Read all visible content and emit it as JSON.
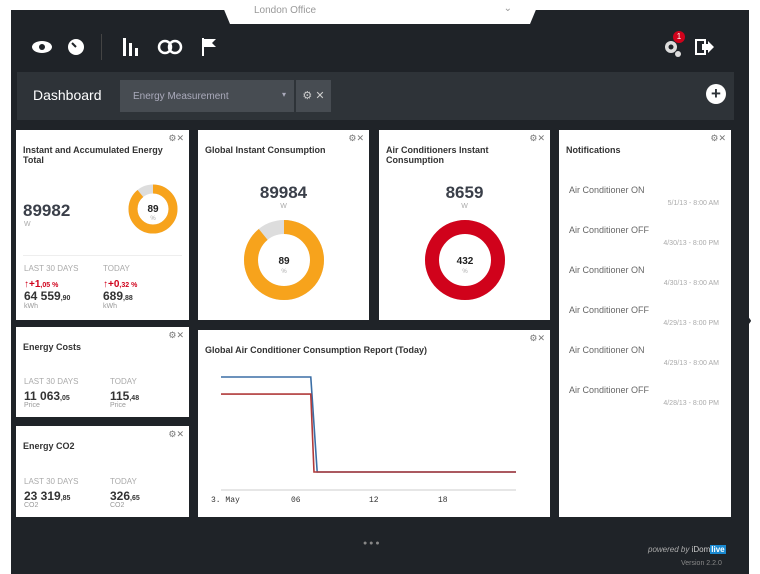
{
  "location": {
    "label": "London Office"
  },
  "nav": {
    "icons": [
      "eye-icon",
      "gauge-icon",
      "bar-chart-icon",
      "loop-icon",
      "flag-icon"
    ]
  },
  "header": {
    "notification_count": "1"
  },
  "toolbar": {
    "title": "Dashboard",
    "selector_value": "Energy Measurement",
    "controls": "⚙ ✕",
    "add": "+"
  },
  "widgets": {
    "instant_accumulated": {
      "title": "Instant and Accumulated Energy Total",
      "value": "89982",
      "unit": "W",
      "gauge": "89",
      "gauge_unit": "%",
      "gauge_fraction": 0.89,
      "last30_label": "LAST 30 DAYS",
      "last30_change": "+1",
      "last30_change_dec": ",05 %",
      "last30_value": "64 559",
      "last30_dec": ",90",
      "last30_unit": "kWh",
      "today_label": "TODAY",
      "today_change": "+0",
      "today_change_dec": ",32 %",
      "today_value": "689",
      "today_dec": ",88",
      "today_unit": "kWh"
    },
    "global_instant": {
      "title": "Global Instant Consumption",
      "value": "89984",
      "unit": "W",
      "gauge": "89",
      "gauge_unit": "%",
      "gauge_fraction": 0.89
    },
    "ac_instant": {
      "title": "Air Conditioners Instant Consumption",
      "value": "8659",
      "unit": "W",
      "gauge": "432",
      "gauge_unit": "%",
      "gauge_fraction": 1.0
    },
    "energy_costs": {
      "title": "Energy Costs",
      "last30_label": "LAST 30 DAYS",
      "last30_value": "11 063",
      "last30_dec": ",05",
      "last30_unit": "Price",
      "today_label": "TODAY",
      "today_value": "115",
      "today_dec": ",48",
      "today_unit": "Price"
    },
    "energy_co2": {
      "title": "Energy CO2",
      "last30_label": "LAST 30 DAYS",
      "last30_value": "23 319",
      "last30_dec": ",85",
      "last30_unit": "CO2",
      "today_label": "TODAY",
      "today_value": "326",
      "today_dec": ",65",
      "today_unit": "CO2"
    },
    "ac_report": {
      "title": "Global Air Conditioner Consumption Report (Today)"
    },
    "notifications": {
      "title": "Notifications",
      "items": [
        {
          "text": "Air Conditioner ON",
          "date": "5/1/13 - 8:00 AM"
        },
        {
          "text": "Air Conditioner OFF",
          "date": "4/30/13 - 8:00 PM"
        },
        {
          "text": "Air Conditioner ON",
          "date": "4/30/13 - 8:00 AM"
        },
        {
          "text": "Air Conditioner OFF",
          "date": "4/29/13 - 8:00 PM"
        },
        {
          "text": "Air Conditioner ON",
          "date": "4/29/13 - 8:00 AM"
        },
        {
          "text": "Air Conditioner OFF",
          "date": "4/28/13 - 8:00 PM"
        }
      ]
    }
  },
  "colors": {
    "orange": "#f7a31c",
    "red": "#d0021b",
    "blue": "#3b6ea5",
    "chart_red": "#b03a3a"
  },
  "chart_data": {
    "type": "line",
    "x_ticks": [
      "3. May",
      "06",
      "12",
      "18"
    ],
    "series": [
      {
        "values": [
          {
            "x": "3. May 00:00",
            "y": 1
          },
          {
            "x": "3. May 07:00",
            "y": 1
          },
          {
            "x": "3. May 07:30",
            "y": 0
          },
          {
            "x": "3. May 23:00",
            "y": 0
          }
        ]
      },
      {
        "values": [
          {
            "x": "3. May 00:00",
            "y": 0.82
          },
          {
            "x": "3. May 07:00",
            "y": 0.82
          },
          {
            "x": "3. May 07:15",
            "y": 0
          },
          {
            "x": "3. May 23:00",
            "y": 0
          }
        ]
      }
    ]
  },
  "footer": {
    "powered": "powered by",
    "brand_a": "iDom",
    "brand_b": "live",
    "version": "Version 2.2.0"
  }
}
